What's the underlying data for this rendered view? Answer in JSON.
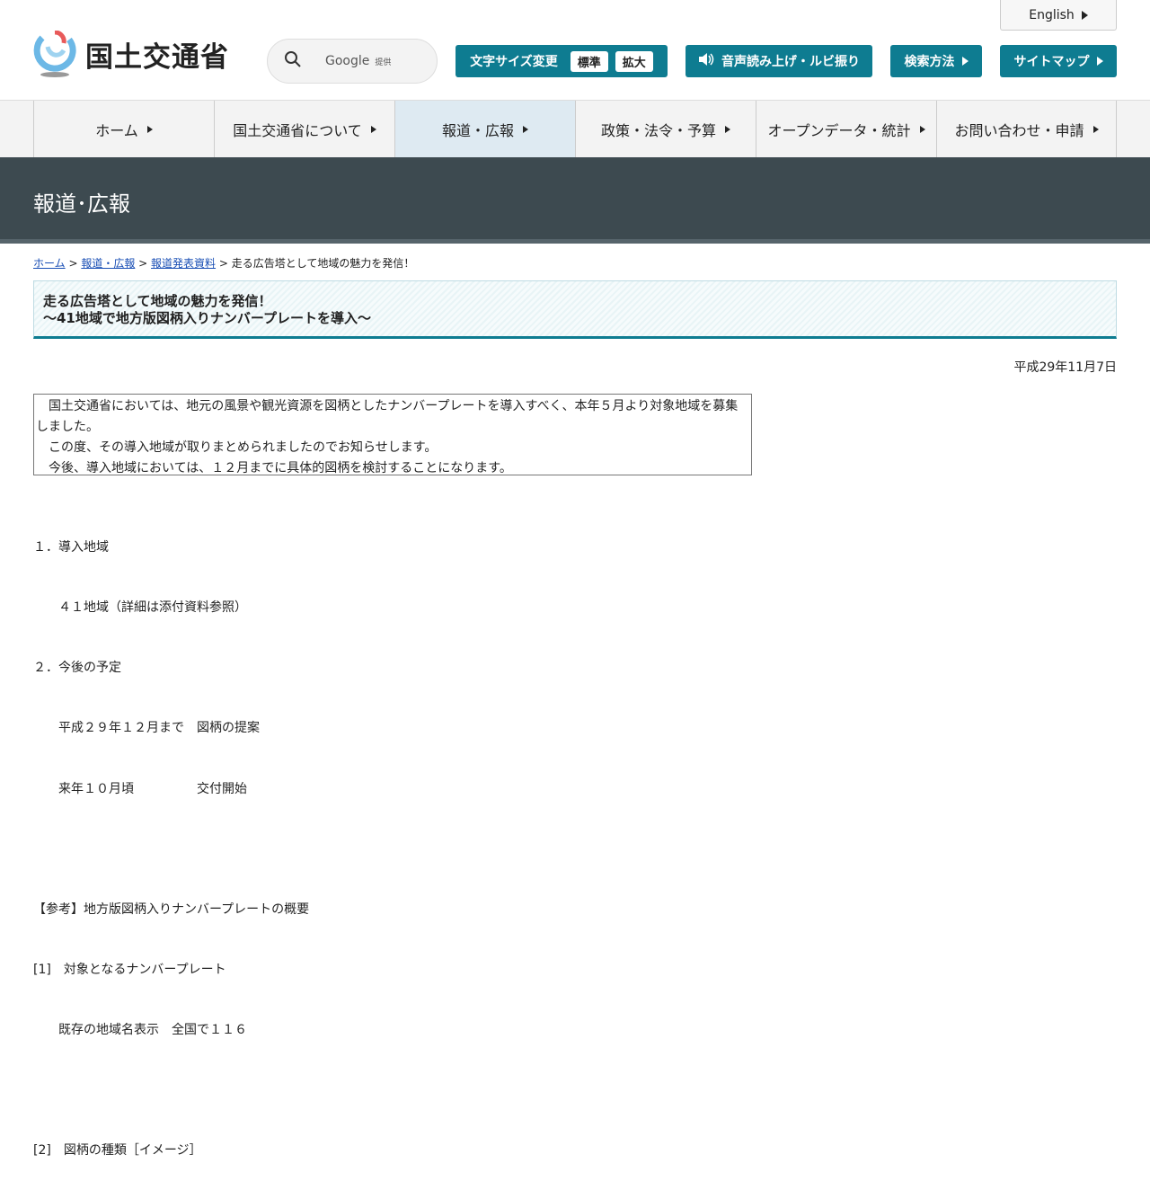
{
  "header": {
    "logo_text": "国土交通省",
    "search_provider": "Google",
    "search_provider_suffix": "提供",
    "english": "English",
    "font_size_label": "文字サイズ変更",
    "font_standard": "標準",
    "font_large": "拡大",
    "speech": "音声読み上げ・ルビ振り",
    "search_method": "検索方法",
    "sitemap": "サイトマップ"
  },
  "nav": [
    "ホーム",
    "国土交通省について",
    "報道・広報",
    "政策・法令・予算",
    "オープンデータ・統計",
    "お問い合わせ・申請"
  ],
  "banner": "報道･広報",
  "breadcrumb": {
    "home": "ホーム",
    "news": "報道・広報",
    "press": "報道発表資料",
    "current": "走る広告塔として地域の魅力を発信！"
  },
  "title_line1": "走る広告塔として地域の魅力を発信！",
  "title_line2": "～41地域で地方版図柄入りナンバープレートを導入～",
  "date": "平成29年11月7日",
  "summary": [
    "　国土交通省においては、地元の風景や観光資源を図柄としたナンバープレートを導入すべく、本年５月より対象地域を募集しました。",
    "　この度、その導入地域が取りまとめられましたのでお知らせします。",
    "　今後、導入地域においては、１２月までに具体的図柄を検討することになります。"
  ],
  "body_lines": [
    "１．導入地域",
    "　　４１地域（詳細は添付資料参照）",
    "２．今後の予定",
    "　　平成２９年１２月まで　図柄の提案",
    "　　来年１０月頃　　　　　交付開始",
    "",
    "【参考】地方版図柄入りナンバープレートの概要",
    "[1]　対象となるナンバープレート",
    "　　既存の地域名表示　全国で１１６",
    "",
    "[2]　図柄の種類［イメージ］"
  ]
}
